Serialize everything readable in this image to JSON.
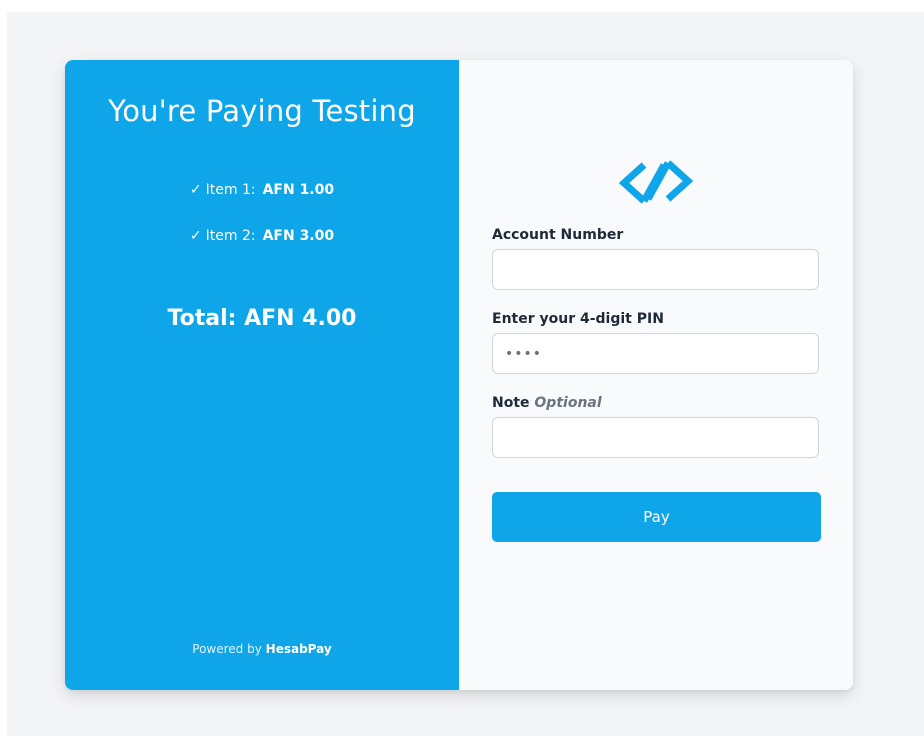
{
  "summary": {
    "title": "You're Paying Testing",
    "check_mark": "✓",
    "items": [
      {
        "label": "Item 1:",
        "amount": "AFN 1.00"
      },
      {
        "label": "Item 2:",
        "amount": "AFN 3.00"
      }
    ],
    "total": "Total: AFN 4.00",
    "powered_prefix": "Powered by",
    "powered_brand": "HesabPay"
  },
  "form": {
    "logo_icon": "hesabpay-logo-icon",
    "account_label": "Account Number",
    "account_value": "",
    "pin_label": "Enter your 4-digit PIN",
    "pin_placeholder": "••••",
    "note_label": "Note",
    "note_optional": "Optional",
    "note_value": "",
    "pay_label": "Pay"
  },
  "colors": {
    "accent": "#0ea5e9",
    "page_bg": "#f3f4f6",
    "form_bg": "#f8fafc"
  }
}
